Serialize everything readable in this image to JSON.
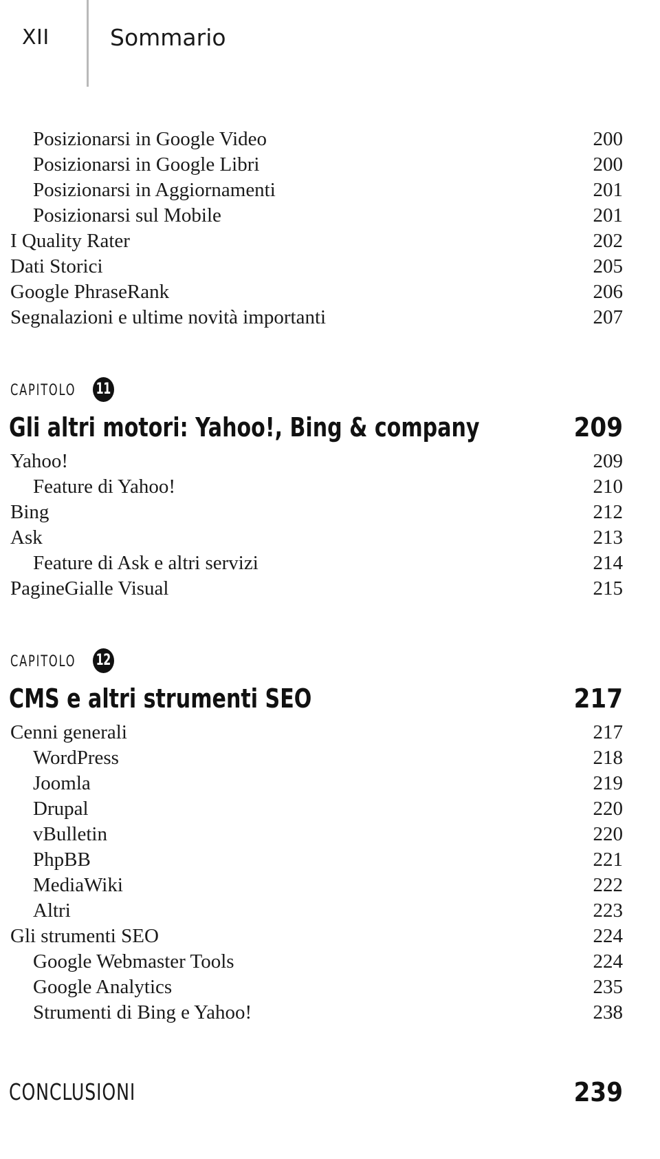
{
  "header": {
    "folio": "XII",
    "title": "Sommario"
  },
  "toc": {
    "leading_entries": [
      {
        "label": "Posizionarsi in Google Video",
        "page": "200",
        "level": 2
      },
      {
        "label": "Posizionarsi in Google Libri",
        "page": "200",
        "level": 2
      },
      {
        "label": "Posizionarsi in Aggiornamenti",
        "page": "201",
        "level": 2
      },
      {
        "label": "Posizionarsi sul Mobile",
        "page": "201",
        "level": 2
      },
      {
        "label": "I Quality Rater",
        "page": "202",
        "level": 1
      },
      {
        "label": "Dati Storici",
        "page": "205",
        "level": 1
      },
      {
        "label": "Google PhraseRank",
        "page": "206",
        "level": 1
      },
      {
        "label": "Segnalazioni e ultime novità importanti",
        "page": "207",
        "level": 1
      }
    ],
    "chapters": [
      {
        "kicker": "CAPITOLO",
        "number": "11",
        "title": "Gli altri motori: Yahoo!, Bing & company",
        "page": "209",
        "entries": [
          {
            "label": "Yahoo!",
            "page": "209",
            "level": 1
          },
          {
            "label": "Feature di Yahoo!",
            "page": "210",
            "level": 2
          },
          {
            "label": "Bing",
            "page": "212",
            "level": 1
          },
          {
            "label": "Ask",
            "page": "213",
            "level": 1
          },
          {
            "label": "Feature di Ask e altri servizi",
            "page": "214",
            "level": 2
          },
          {
            "label": "PagineGialle Visual",
            "page": "215",
            "level": 1
          }
        ]
      },
      {
        "kicker": "CAPITOLO",
        "number": "12",
        "title": "CMS e altri strumenti SEO",
        "page": "217",
        "entries": [
          {
            "label": "Cenni generali",
            "page": "217",
            "level": 1
          },
          {
            "label": "WordPress",
            "page": "218",
            "level": 2
          },
          {
            "label": "Joomla",
            "page": "219",
            "level": 2
          },
          {
            "label": "Drupal",
            "page": "220",
            "level": 2
          },
          {
            "label": "vBulletin",
            "page": "220",
            "level": 2
          },
          {
            "label": "PhpBB",
            "page": "221",
            "level": 2
          },
          {
            "label": "MediaWiki",
            "page": "222",
            "level": 2
          },
          {
            "label": "Altri",
            "page": "223",
            "level": 2
          },
          {
            "label": "Gli strumenti SEO",
            "page": "224",
            "level": 1
          },
          {
            "label": "Google Webmaster Tools",
            "page": "224",
            "level": 2
          },
          {
            "label": "Google Analytics",
            "page": "235",
            "level": 2
          },
          {
            "label": "Strumenti di Bing e Yahoo!",
            "page": "238",
            "level": 2
          }
        ]
      }
    ],
    "closing": {
      "label": "CONCLUSIONI",
      "page": "239"
    }
  },
  "colors": {
    "text": "#1a1a1a",
    "heading": "#111111",
    "badge_background": "#111111",
    "badge_text": "#ffffff",
    "header_rule": "#b9b9b9",
    "page_background": "#ffffff"
  }
}
